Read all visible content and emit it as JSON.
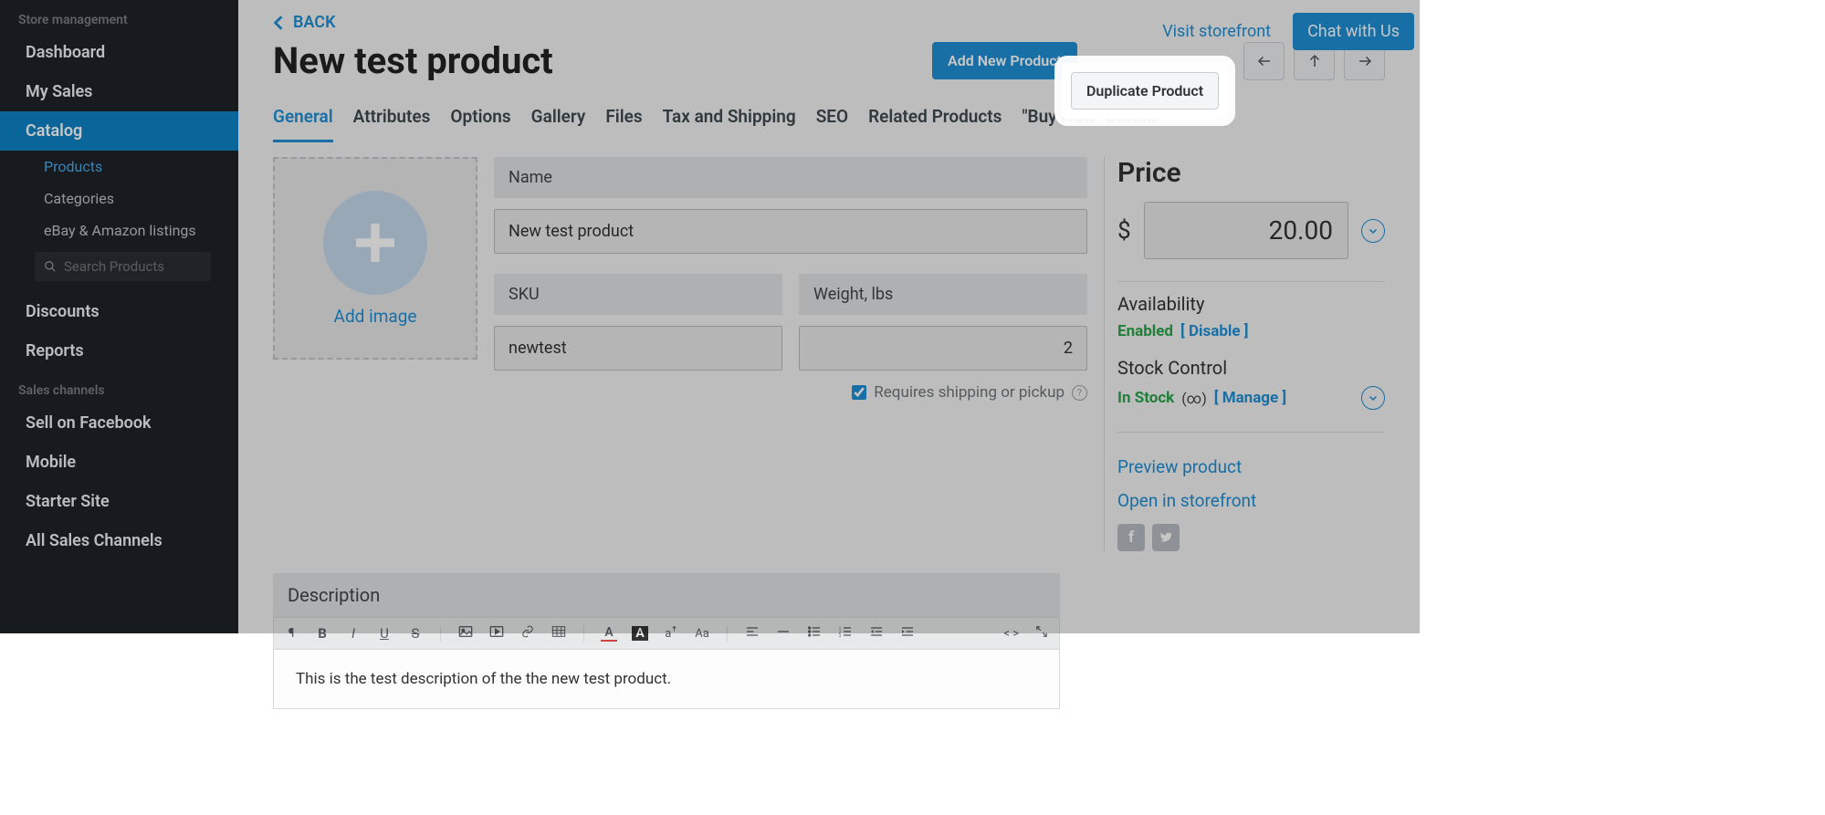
{
  "sidebar": {
    "section1_title": "Store management",
    "items": [
      {
        "label": "Dashboard"
      },
      {
        "label": "My Sales"
      },
      {
        "label": "Catalog",
        "active": true
      },
      {
        "label": "Discounts"
      },
      {
        "label": "Reports"
      }
    ],
    "catalog_sub": [
      {
        "label": "Products",
        "active": true
      },
      {
        "label": "Categories"
      },
      {
        "label": "eBay & Amazon listings"
      }
    ],
    "search_placeholder": "Search Products",
    "section2_title": "Sales channels",
    "channel_items": [
      {
        "label": "Sell on Facebook"
      },
      {
        "label": "Mobile"
      },
      {
        "label": "Starter Site"
      },
      {
        "label": "All Sales Channels"
      }
    ]
  },
  "topbar": {
    "visit_storefront": "Visit storefront",
    "chat_with_us": "Chat with Us"
  },
  "header": {
    "back_label": "BACK",
    "page_title": "New test product",
    "add_new_product": "Add New Product",
    "duplicate_product": "Duplicate Product"
  },
  "tabs": [
    {
      "label": "General",
      "active": true
    },
    {
      "label": "Attributes"
    },
    {
      "label": "Options"
    },
    {
      "label": "Gallery"
    },
    {
      "label": "Files"
    },
    {
      "label": "Tax and Shipping"
    },
    {
      "label": "SEO"
    },
    {
      "label": "Related Products"
    },
    {
      "label": "\"Buy Now\" button"
    }
  ],
  "image_uploader": {
    "add_image": "Add image"
  },
  "fields": {
    "name_label": "Name",
    "name_value": "New test product",
    "sku_label": "SKU",
    "sku_value": "newtest",
    "weight_label": "Weight, lbs",
    "weight_value": "2",
    "requires_shipping_label": "Requires shipping or pickup",
    "requires_shipping_checked": true
  },
  "description": {
    "title": "Description",
    "body": "This is the test description of the the new test product."
  },
  "price_panel": {
    "price_title": "Price",
    "currency_symbol": "$",
    "price_value": "20.00",
    "availability_title": "Availability",
    "enabled_text": "Enabled",
    "disable_link": "[ Disable ]",
    "stock_control_title": "Stock Control",
    "in_stock_text": "In Stock",
    "infinity_text": "(∞)",
    "manage_link": "[ Manage ]",
    "preview_product": "Preview product",
    "open_in_storefront": "Open in storefront"
  },
  "toolbar_icons": {
    "pilcrow": "¶",
    "bold": "B",
    "italic": "I",
    "underline": "U",
    "strike": "S",
    "textcolor": "A",
    "bgcolor": "A",
    "fontsize": "aꜛ",
    "fontcase": "Aa",
    "code": "< >"
  }
}
